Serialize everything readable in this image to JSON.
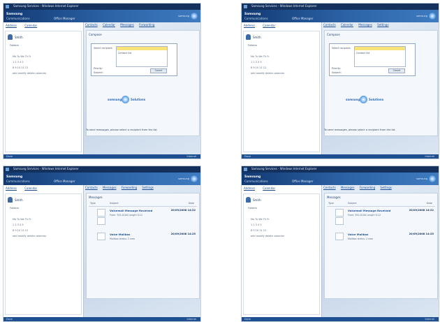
{
  "window_title": "Samsung Services - Windows Internet Explorer",
  "banner": {
    "brand": "Samsung",
    "subtitle": "Communications",
    "center_text": "Office Manager",
    "logo_text": "samsung"
  },
  "left_tabs": [
    "Address",
    "Calendar"
  ],
  "user_name": "Smith",
  "left_section": "Folders",
  "calendar_rows": [
    "Mo   Tu   We   Th   Fr",
    "1    2    3    4    5",
    "8    9   10   11   12",
    "add   modify   delete   calendar"
  ],
  "right_tabs": [
    "Contacts",
    "Calendar",
    "Messages",
    "Forwarding",
    "Settings"
  ],
  "panel_title": "Compose",
  "dialog": {
    "label1": "Select recipient:",
    "label2": "Priority:",
    "label3": "Subject:",
    "button": "Cancel",
    "item": "Contact list"
  },
  "center_logo_left": "samsung",
  "center_logo_right": "Solutions",
  "status_text": "To send messages, please select a recipient from the list",
  "messages": {
    "header": [
      "Type",
      "Subject",
      "Date"
    ],
    "rows": [
      {
        "title": "Voicemail Message Received",
        "sub": "From: 555-0100  Length 0:12",
        "date": "20/09/2008 14:22"
      },
      {
        "title": "Voice Mailbox",
        "sub": "Mailbox status: 2 new",
        "date": "20/09/2008 14:25"
      }
    ]
  },
  "footer": {
    "left": "Done",
    "right": "Internet"
  },
  "colors": {
    "banner": "#2d64a8",
    "titlebar": "#14315e",
    "highlight": "#f8e27a",
    "footer": "#1e4f91"
  }
}
